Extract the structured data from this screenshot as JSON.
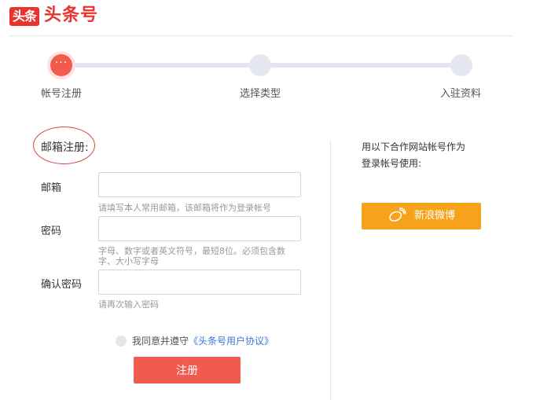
{
  "header": {
    "logo_badge": "头条",
    "logo_text": "头条号"
  },
  "steps": [
    {
      "label": "帐号注册",
      "active": true,
      "dot_text": "···"
    },
    {
      "label": "选择类型",
      "active": false
    },
    {
      "label": "入驻资料",
      "active": false
    }
  ],
  "form": {
    "section_title": "邮箱注册:",
    "email": {
      "label": "邮箱",
      "value": "",
      "placeholder": "",
      "hint": "请填写本人常用邮箱，该邮箱将作为登录帐号"
    },
    "password": {
      "label": "密码",
      "value": "",
      "placeholder": "",
      "hint_line1": "字母、数字或者英文符号，最短8位。必须包含数",
      "hint_line2": "字、大小写字母"
    },
    "confirm": {
      "label": "确认密码",
      "value": "",
      "placeholder": "",
      "hint": "请再次输入密码"
    },
    "agree_text": "我同意并遵守",
    "agree_link": "《头条号用户协议》",
    "submit_label": "注册"
  },
  "partner": {
    "line1": "用以下合作网站帐号作为",
    "line2": "登录帐号使用:",
    "weibo_label": "新浪微博",
    "weibo_icon": "weibo-icon",
    "weibo_color": "#f7a21b"
  },
  "colors": {
    "brand_red": "#e8332e",
    "button_red": "#f05b4f",
    "link_blue": "#3a78d8"
  }
}
